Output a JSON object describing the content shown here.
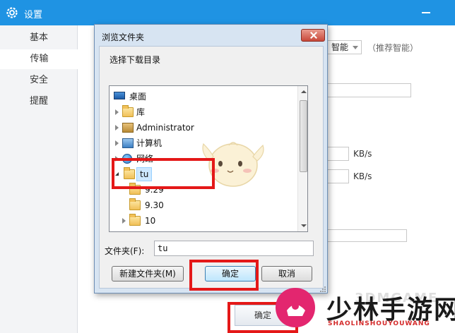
{
  "settings": {
    "title": "设置",
    "sidebar": [
      {
        "label": "基本",
        "active": false
      },
      {
        "label": "传输",
        "active": true
      },
      {
        "label": "安全",
        "active": false
      },
      {
        "label": "提醒",
        "active": false
      }
    ],
    "smart_select_value": "智能",
    "smart_hint": "（推荐智能）",
    "kb_unit_1": "KB/s",
    "kb_unit_2": "KB/s",
    "bottom_button": "确定"
  },
  "dialog": {
    "title": "浏览文件夹",
    "description": "选择下载目录",
    "tree": [
      {
        "label": "桌面",
        "icon": "desktop-icon",
        "depth": 0,
        "expander": "none"
      },
      {
        "label": "库",
        "icon": "library-folder-icon",
        "depth": 1,
        "expander": "closed"
      },
      {
        "label": "Administrator",
        "icon": "user-folder-icon",
        "depth": 1,
        "expander": "closed"
      },
      {
        "label": "计算机",
        "icon": "computer-icon",
        "depth": 1,
        "expander": "closed"
      },
      {
        "label": "网络",
        "icon": "network-icon",
        "depth": 1,
        "expander": "closed"
      },
      {
        "label": "tu",
        "icon": "folder-icon",
        "depth": 1,
        "expander": "open",
        "selected": true
      },
      {
        "label": "9.29",
        "icon": "folder-icon",
        "depth": 2,
        "expander": "none"
      },
      {
        "label": "9.30",
        "icon": "folder-icon",
        "depth": 2,
        "expander": "none"
      },
      {
        "label": "10",
        "icon": "folder-icon",
        "depth": 2,
        "expander": "closed"
      }
    ],
    "folder_label": "文件夹(F):",
    "folder_value": "tu",
    "buttons": {
      "new_folder": "新建文件夹(M)",
      "ok": "确定",
      "cancel": "取消"
    }
  },
  "watermark": {
    "text": "少林手游网",
    "subtext": "SHAOLINSHOUYOUWANG",
    "faint": "3DMGAME"
  },
  "colors": {
    "titlebar": "#1f93e3",
    "highlight": "#e41818",
    "dialog_frame": "#d7e4f2"
  }
}
